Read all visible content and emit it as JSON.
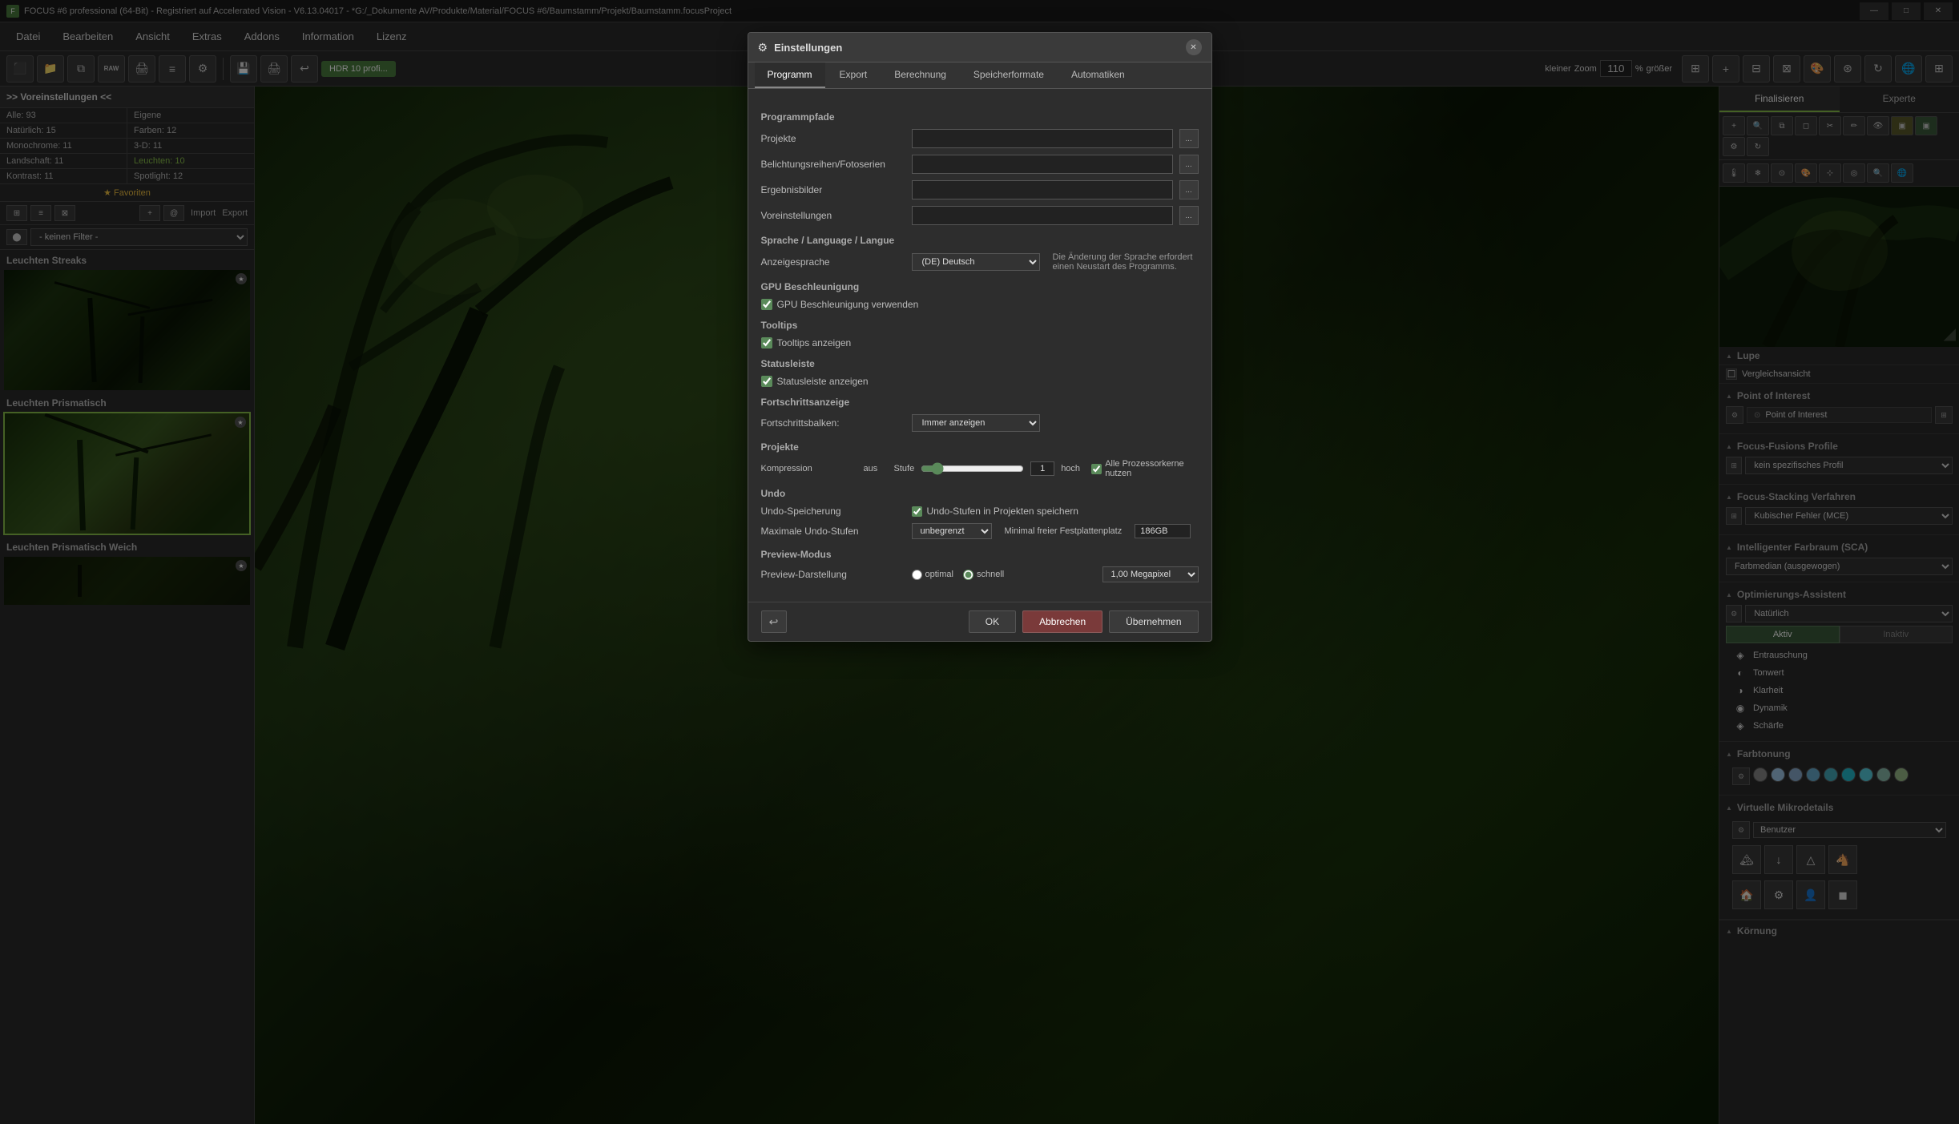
{
  "window": {
    "title": "FOCUS #6 professional (64-Bit) - Registriert auf Accelerated Vision - V6.13.04017 - *G:/_Dokumente AV/Produkte/Material/FOCUS #6/Baumstamm/Projekt/Baumstamm.focusProject",
    "controls": {
      "minimize": "—",
      "maximize": "□",
      "close": "✕"
    }
  },
  "menu": {
    "items": [
      "Datei",
      "Bearbeiten",
      "Ansicht",
      "Extras",
      "Addons",
      "Information",
      "Lizenz"
    ]
  },
  "toolbar": {
    "zoom_label": "Zoom",
    "zoom_value": "110",
    "zoom_unit": "%",
    "zoom_kleiner": "kleiner",
    "zoom_groesser": "größer",
    "hdr_label": "HDR 10 profi..."
  },
  "left_panel": {
    "presets_title": ">> Voreinstellungen <<",
    "stats": [
      {
        "label": "Alle:",
        "value": "93"
      },
      {
        "label": "Eigene",
        "value": ""
      },
      {
        "label": "Natürlich:",
        "value": "15"
      },
      {
        "label": "Farben:",
        "value": "12"
      },
      {
        "label": "Monochrome:",
        "value": "11"
      },
      {
        "label": "3-D:",
        "value": "11"
      },
      {
        "label": "Landschaft:",
        "value": "11"
      },
      {
        "label": "Leuchten:",
        "value": "10"
      },
      {
        "label": "Kontrast:",
        "value": "11"
      },
      {
        "label": "Spotlight:",
        "value": "12"
      }
    ],
    "favorites_label": "★ Favoriten",
    "import_label": "Import",
    "export_label": "Export",
    "filter_placeholder": "- keinen Filter -",
    "preset_sections": [
      {
        "title": "Leuchten Streaks",
        "items": []
      },
      {
        "title": "Leuchten Prismatisch",
        "items": []
      },
      {
        "title": "Leuchten Prismatisch Weich",
        "items": []
      }
    ]
  },
  "modal": {
    "title": "Einstellungen",
    "icon": "⚙",
    "tabs": [
      "Programm",
      "Export",
      "Berechnung",
      "Speicherformate",
      "Automatiken"
    ],
    "active_tab": "Programm",
    "sections": {
      "programmpfade": {
        "title": "Programmpfade",
        "rows": [
          {
            "label": "Projekte",
            "value": "",
            "dots": "..."
          },
          {
            "label": "Belichtungsreihen/Fotoserien",
            "value": "",
            "dots": "..."
          },
          {
            "label": "Ergebnisbilder",
            "value": "",
            "dots": "..."
          },
          {
            "label": "Voreinstellungen",
            "value": "",
            "dots": "..."
          }
        ]
      },
      "sprache": {
        "title": "Sprache / Language / Langue",
        "language_label": "Anzeigesprache",
        "language_value": "(DE) Deutsch",
        "language_note": "Die Änderung der Sprache erfordert einen Neustart des Programms."
      },
      "gpu": {
        "title": "GPU Beschleunigung",
        "checkbox_label": "GPU Beschleunigung verwenden",
        "checked": true
      },
      "tooltips": {
        "title": "Tooltips",
        "checkbox_label": "Tooltips anzeigen",
        "checked": true
      },
      "statusleiste": {
        "title": "Statusleiste",
        "checkbox_label": "Statusleiste anzeigen",
        "checked": true
      },
      "fortschrittsanzeige": {
        "title": "Fortschrittsanzeige",
        "balken_label": "Fortschrittsbalken:",
        "balken_value": "Immer anzeigen"
      },
      "projekte": {
        "title": "Projekte",
        "kompression_label": "Kompression",
        "aus_label": "aus",
        "stufe_label": "Stufe",
        "stufe_value": "1",
        "hoch_label": "hoch",
        "cores_label": "Alle Prozessorkerne nutzen",
        "cores_checked": true
      },
      "undo": {
        "title": "Undo",
        "speicherung_label": "Undo-Speicherung",
        "speicherung_checkbox": "Undo-Stufen in Projekten speichern",
        "speicherung_checked": true,
        "max_stufen_label": "Maximale Undo-Stufen",
        "max_stufen_value": "unbegrenzt",
        "freier_platz_label": "Minimal freier Festplattenplatz",
        "freier_platz_value": "186GB"
      },
      "preview": {
        "title": "Preview-Modus",
        "darstellung_label": "Preview-Darstellung",
        "optimal_label": "optimal",
        "schnell_label": "schnell",
        "mp_value": "1,00 Megapixel"
      }
    },
    "footer": {
      "ok_label": "OK",
      "cancel_label": "Abbrechen",
      "apply_label": "Übernehmen"
    }
  },
  "right_panel": {
    "tabs": [
      "Finalisieren",
      "Experte"
    ],
    "active_tab": "Finalisieren",
    "lupe_label": "Lupe",
    "vergleichsansicht_label": "Vergleichsansicht",
    "point_of_interest": {
      "section_title": "Point of Interest",
      "item_label": "Point of Interest"
    },
    "focus_fusion": {
      "title": "Focus-Fusions Profile",
      "value": "kein spezifisches Profil"
    },
    "focus_stacking": {
      "title": "Focus-Stacking Verfahren",
      "value": "Kubischer Fehler (MCE)"
    },
    "farbraum": {
      "title": "Intelligenter Farbraum (SCA)",
      "value": "Farbmedian (ausgewogen)"
    },
    "optimierungs": {
      "title": "Optimierungs-Assistent",
      "value": "Natürlich"
    },
    "aktiv_label": "Aktiv",
    "inaktiv_label": "Inaktiv",
    "effects": [
      {
        "label": "Entrauschung",
        "icon": "◈"
      },
      {
        "label": "Tonwert",
        "icon": "◐"
      },
      {
        "label": "Klarheit",
        "icon": "◑"
      },
      {
        "label": "Dynamik",
        "icon": "◉"
      },
      {
        "label": "Schärfe",
        "icon": "◈"
      }
    ],
    "farbtonung": {
      "title": "Farbtonung",
      "colors": [
        "#888",
        "#aaa",
        "#8ab",
        "#7ac",
        "#6bd",
        "#5ce",
        "#4df",
        "#8ba",
        "#9b8"
      ]
    },
    "mikrodetails": {
      "title": "Virtuelle Mikrodetails",
      "value": "Benutzer"
    },
    "detail_icons": [
      "🏔",
      "⬇",
      "🏔",
      "🐎",
      "🏠",
      "⚙",
      "👤",
      "◼"
    ],
    "kornung": {
      "title": "Körnung"
    }
  }
}
